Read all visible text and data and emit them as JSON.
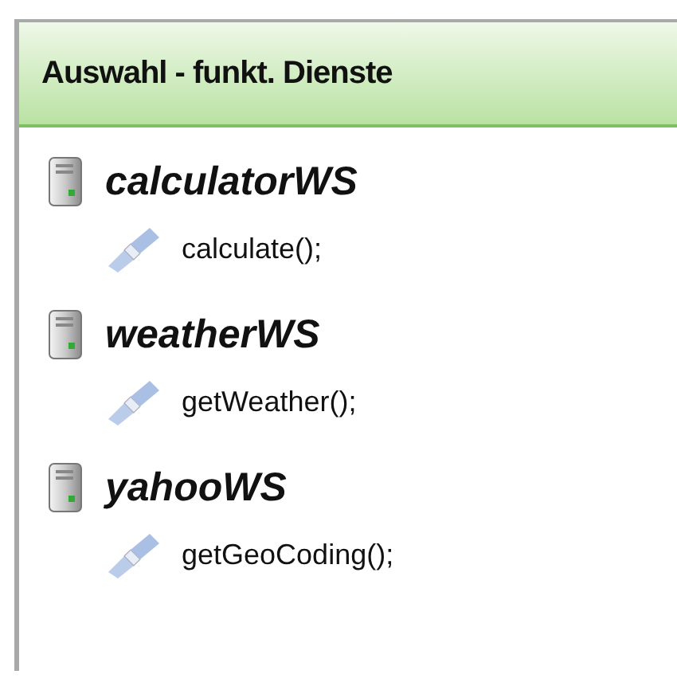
{
  "panel": {
    "title": "Auswahl - funkt. Dienste"
  },
  "services": [
    {
      "name": "calculatorWS",
      "methods": [
        {
          "name": "calculate();"
        }
      ]
    },
    {
      "name": "weatherWS",
      "methods": [
        {
          "name": "getWeather();"
        }
      ]
    },
    {
      "name": "yahooWS",
      "methods": [
        {
          "name": "getGeoCoding();"
        }
      ]
    }
  ]
}
